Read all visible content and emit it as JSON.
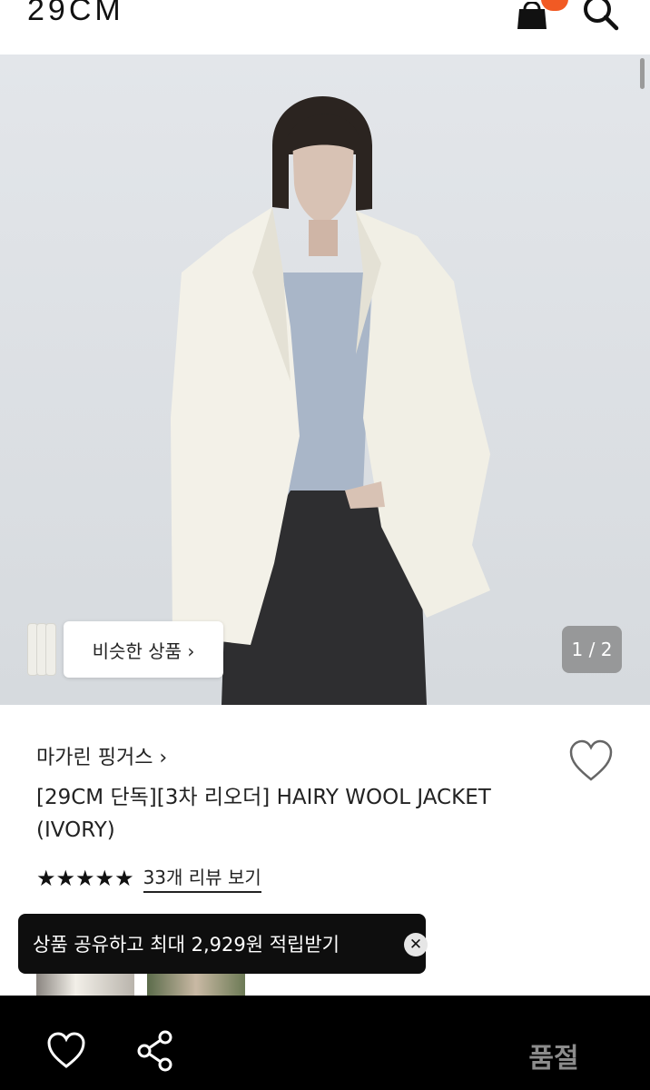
{
  "header": {
    "logo": "29CM",
    "cart_icon": "shopping-bag-icon",
    "search_icon": "search-icon",
    "accent": "#f15a24"
  },
  "gallery": {
    "similar_label": "비슷한 상품 ›",
    "counter": "1 / 2"
  },
  "product": {
    "brand": "마가린 핑거스 ›",
    "title": "[29CM 단독][3차 리오더] HAIRY WOOL JACKET (IVORY)",
    "stars": "★★★★★",
    "reviews_link": "33개 리뷰 보기"
  },
  "toast": {
    "message": "상품 공유하고 최대 2,929원 적립받기",
    "close": "✕"
  },
  "bottom_bar": {
    "soldout_label": "품절",
    "heart_icon": "heart-outline-icon",
    "share_icon": "share-icon"
  }
}
